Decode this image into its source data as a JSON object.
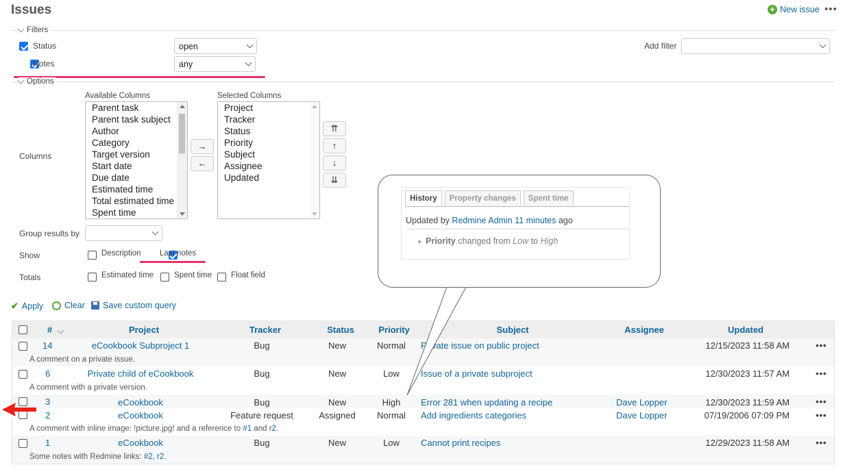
{
  "header": {
    "title": "Issues",
    "new_issue": "New issue",
    "menu": "•••"
  },
  "filters": {
    "legend": "Filters",
    "status": {
      "label": "Status",
      "value": "open",
      "checked": true
    },
    "notes": {
      "label": "Notes",
      "value": "any",
      "checked": true
    },
    "add_filter_label": "Add filter",
    "add_filter_value": ""
  },
  "options": {
    "legend": "Options",
    "columns_label": "Columns",
    "available_label": "Available Columns",
    "available": [
      "Parent task",
      "Parent task subject",
      "Author",
      "Category",
      "Target version",
      "Start date",
      "Due date",
      "Estimated time",
      "Total estimated time",
      "Spent time"
    ],
    "selected_label": "Selected Columns",
    "selected": [
      "Project",
      "Tracker",
      "Status",
      "Priority",
      "Subject",
      "Assignee",
      "Updated"
    ],
    "move_right": "→",
    "move_left": "←",
    "move_top": "⇈",
    "move_up": "↑",
    "move_down": "↓",
    "move_bottom": "⇊",
    "group_label": "Group results by",
    "group_value": "",
    "show_label": "Show",
    "show_description": "Description",
    "show_last_notes": "Last notes",
    "totals_label": "Totals",
    "total_estimated": "Estimated time",
    "total_spent": "Spent time",
    "total_float": "Float field"
  },
  "actions": {
    "apply": "Apply",
    "clear": "Clear",
    "save": "Save custom query"
  },
  "table": {
    "headers": {
      "id": "#",
      "project": "Project",
      "tracker": "Tracker",
      "status": "Status",
      "priority": "Priority",
      "subject": "Subject",
      "assignee": "Assignee",
      "updated": "Updated"
    },
    "rows": [
      {
        "id": "14",
        "project": "eCookbook Subproject 1",
        "tracker": "Bug",
        "status": "New",
        "priority": "Normal",
        "subject": "Private issue on public project",
        "assignee": "",
        "updated": "12/15/2023 11:58 AM",
        "note": "A comment on a private issue."
      },
      {
        "id": "6",
        "project": "Private child of eCookbook",
        "tracker": "Bug",
        "status": "New",
        "priority": "Low",
        "subject": "Issue of a private subproject",
        "assignee": "",
        "updated": "12/30/2023 11:57 AM",
        "note": "A comment with a private version."
      },
      {
        "id": "3",
        "project": "eCookbook",
        "tracker": "Bug",
        "status": "New",
        "priority": "High",
        "subject": "Error 281 when updating a recipe",
        "assignee": "Dave Lopper",
        "updated": "12/30/2023 11:59 AM",
        "note": ""
      },
      {
        "id": "2",
        "project": "eCookbook",
        "tracker": "Feature request",
        "status": "Assigned",
        "priority": "Normal",
        "subject": "Add ingredients categories",
        "assignee": "Dave Lopper",
        "updated": "07/19/2006 07:09 PM",
        "note_prefix": "A comment with inline image: !picture.jpg! and a reference to ",
        "note_link1": "#1",
        "note_mid": " and ",
        "note_link2": "r2",
        "note_suffix": "."
      },
      {
        "id": "1",
        "project": "eCookbook",
        "tracker": "Bug",
        "status": "New",
        "priority": "Low",
        "subject": "Cannot print recipes",
        "assignee": "",
        "updated": "12/29/2023 11:58 AM",
        "note_prefix": "Some notes with Redmine links: ",
        "note_link1": "#2",
        "note_mid": ", ",
        "note_link2": "r2",
        "note_suffix": "."
      }
    ],
    "row_menu": "•••"
  },
  "tooltip": {
    "tabs": [
      "History",
      "Property changes",
      "Spent time"
    ],
    "updated_prefix": "Updated by ",
    "updated_user": "Redmine Admin",
    "updated_ago": "11 minutes",
    "updated_suffix": " ago",
    "detail_field": "Priority",
    "detail_changed": " changed from ",
    "detail_old": "Low",
    "detail_to": " to ",
    "detail_new": "High"
  },
  "colors": {
    "link": "#116699",
    "annotation": "#e8336b",
    "arrow": "#e8221b",
    "checkbox": "#1a73e8"
  }
}
